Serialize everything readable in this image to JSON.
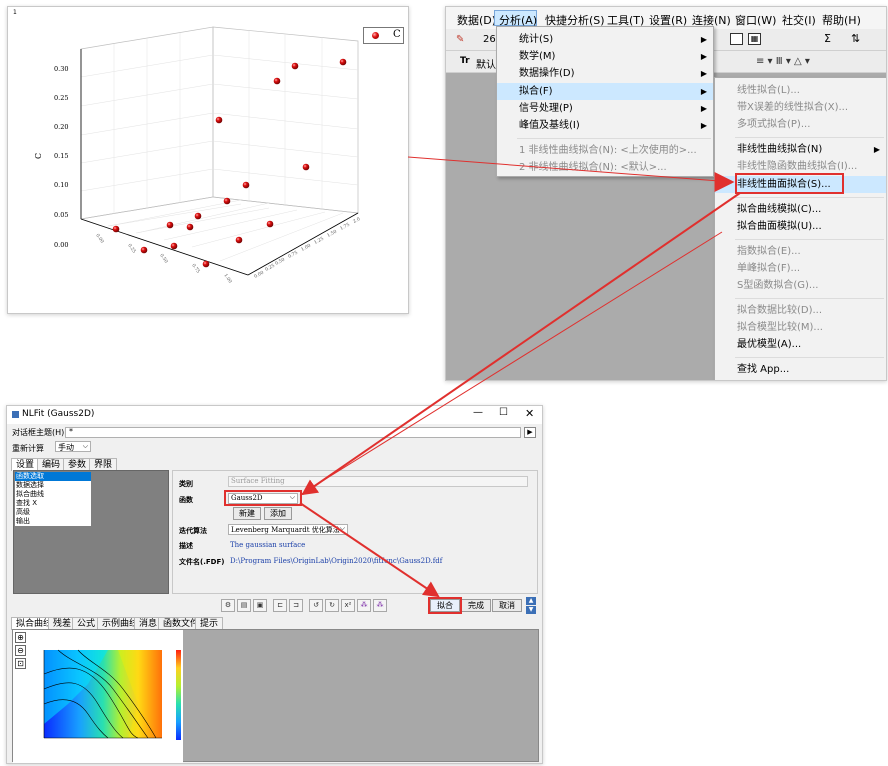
{
  "plot": {
    "corner_label": "1",
    "z_axis_label": "C",
    "z_ticks": [
      "0.30",
      "0.25",
      "0.20",
      "0.15",
      "0.10",
      "0.05",
      "0.00"
    ],
    "legend_label": "C",
    "right_axis_ticks": [
      "2.0",
      "1.75",
      "1.50",
      "1.25",
      "1.00",
      "0.75",
      "0.50",
      "0.25",
      "0.00"
    ],
    "front_axis_ticks": [
      "0.00",
      "0.25",
      "0.50",
      "0.75",
      "1.00"
    ]
  },
  "menubar": {
    "items": [
      "数据(D)",
      "分析(A)",
      "快捷分析(S)",
      "工具(T)",
      "设置(R)",
      "连接(N)",
      "窗口(W)",
      "社交(I)",
      "帮助(H)"
    ],
    "active": "分析(A)",
    "toolbar_zoom": "26",
    "toolbar_font": "默认"
  },
  "analysis_menu": {
    "items": [
      "统计(S)",
      "数学(M)",
      "数据操作(D)",
      "拟合(F)",
      "信号处理(P)",
      "峰值及基线(I)"
    ],
    "highlighted": "拟合(F)",
    "recent": [
      "1 非线性曲线拟合(N): <上次使用的>...",
      "2 非线性曲线拟合(N): <默认>..."
    ]
  },
  "fit_submenu": {
    "group1": [
      "线性拟合(L)...",
      "带X误差的线性拟合(X)...",
      "多项式拟合(P)..."
    ],
    "group2": [
      "非线性曲线拟合(N)",
      "非线性隐函数曲线拟合(I)...",
      "非线性曲面拟合(S)..."
    ],
    "group3": [
      "拟合曲线模拟(C)...",
      "拟合曲面模拟(U)..."
    ],
    "group4": [
      "指数拟合(E)...",
      "单峰拟合(F)...",
      "S型函数拟合(G)..."
    ],
    "group5": [
      "拟合数据比较(D)...",
      "拟合模型比较(M)...",
      "最优模型(A)..."
    ],
    "group6": [
      "查找 App..."
    ],
    "highlighted": "非线性曲面拟合(S)..."
  },
  "nlfit": {
    "title": "NLFit (Gauss2D)",
    "dialog_theme_label": "对话框主题(H)",
    "dialog_theme_value": "*",
    "recalc_label": "重新计算",
    "recalc_value": "手动",
    "tabs": [
      "设置",
      "编码",
      "参数",
      "界限"
    ],
    "tree_items": [
      "函数选取",
      "数据选择",
      "拟合曲线",
      "查找 X",
      "高级",
      "输出"
    ],
    "fields": {
      "category_label": "类别",
      "category_value": "Surface Fitting",
      "function_label": "函数",
      "function_value": "Gauss2D",
      "new_button": "新建",
      "add_button": "添加",
      "algorithm_label": "迭代算法",
      "algorithm_value": "Levenberg Marquardt 优化算法",
      "desc_label": "描述",
      "desc_value": "The gaussian surface",
      "file_label": "文件名(.FDF)",
      "file_value": "D:\\Program Files\\OriginLab\\Origin2020\\fitfunc\\Gauss2D.fdf"
    },
    "buttons": {
      "fit": "拟合",
      "done": "完成",
      "cancel": "取消"
    },
    "bottom_tabs": [
      "拟合曲线",
      "残差",
      "公式",
      "示例曲线",
      "消息",
      "函数文件",
      "提示"
    ]
  },
  "colors": {
    "highlight": "#cce8ff",
    "red": "#e0302e",
    "accent": "#0078d7"
  }
}
